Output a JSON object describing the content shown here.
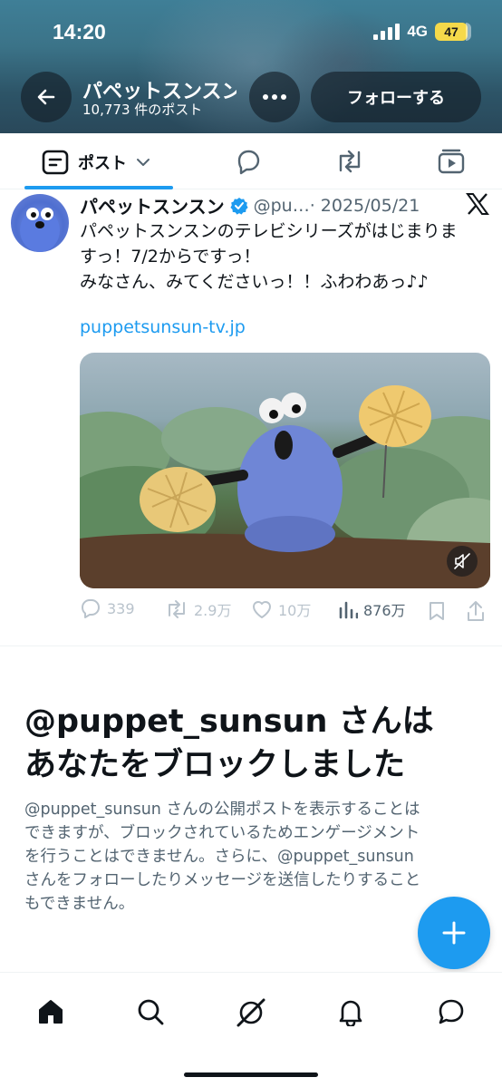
{
  "status_bar": {
    "time": "14:20",
    "network": "4G",
    "battery": "47",
    "battery_color": "#f5d94a"
  },
  "header": {
    "display_name": "パペットスンスン…",
    "post_count": "10,773 件のポスト",
    "follow_label": "フォローする",
    "back_icon": "arrow-left-icon",
    "more_icon": "more-horizontal-icon"
  },
  "tabs": {
    "posts_label": "ポスト",
    "items": [
      "posts-icon",
      "replies-icon",
      "reposts-icon",
      "media-icon"
    ]
  },
  "tweet": {
    "name": "パペットスンスン",
    "verified": true,
    "handle_date": "@pu…· 2025/05/21",
    "text_lines": [
      "パペットスンスンのテレビシリーズがはじまりま",
      "すっ！7/2からですっ！",
      "みなさん、みてくださいっ！！ふわわあっ♪♪"
    ],
    "link": "puppetsunsun-tv.jp",
    "stats": {
      "replies": "339",
      "reposts": "2.9万",
      "likes": "10万",
      "views": "876万"
    }
  },
  "blocked_notice": {
    "title_lines": [
      "@puppet_sunsun さんは",
      "あなたをブロックしました"
    ],
    "body_lines": [
      "@puppet_sunsun さんの公開ポストを表示することは",
      "できますが、ブロックされているためエンゲージメント",
      "を行うことはできません。さらに、@puppet_sunsun",
      "さんをフォローしたりメッセージを送信したりすること",
      "もできません。"
    ]
  },
  "colors": {
    "accent": "#1d9bf0",
    "text": "#0f1419",
    "secondary": "#536471"
  },
  "bottom_nav": [
    "home-icon",
    "search-icon",
    "grok-icon",
    "notifications-icon",
    "messages-icon"
  ]
}
